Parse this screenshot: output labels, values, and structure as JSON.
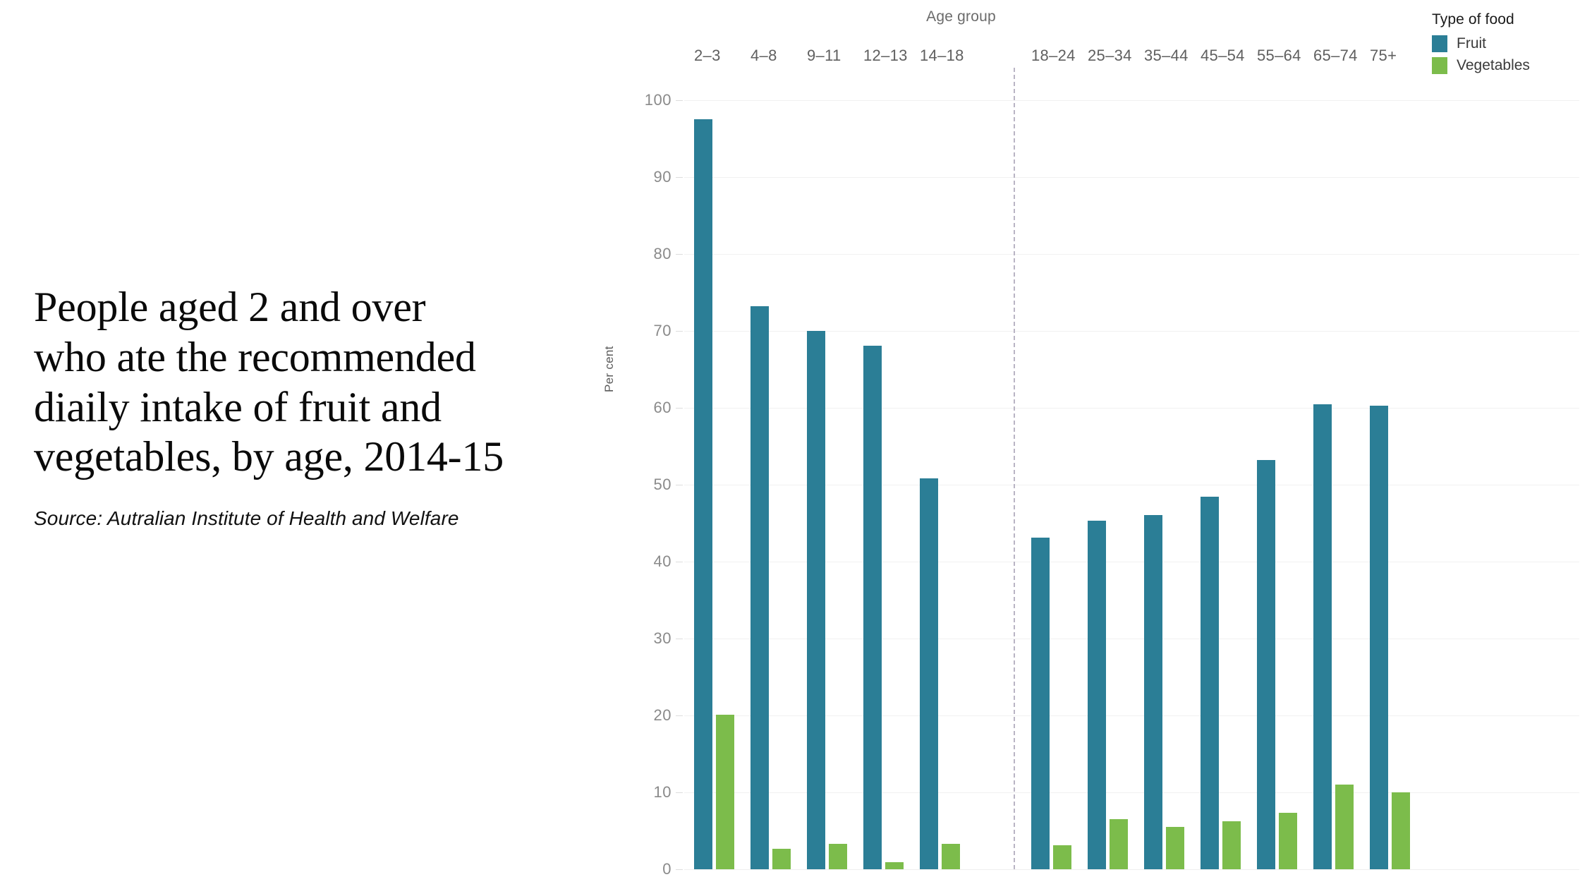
{
  "headline": "People aged 2 and over\nwho ate the recommended\ndiaily intake of fruit and\nvegetables, by age, 2014-15",
  "source": "Source: Autralian Institute of Health and Welfare",
  "legend": {
    "title": "Type of food",
    "items": [
      {
        "label": "Fruit",
        "color": "#2b7e96"
      },
      {
        "label": "Vegetables",
        "color": "#7cbc4b"
      }
    ]
  },
  "chart_data": {
    "type": "bar",
    "title": "People aged 2 and over who ate the recommended diaily intake of fruit and vegetables, by age, 2014-15",
    "subtitle": "Source: Autralian Institute of Health and Welfare",
    "xlabel": "Age group",
    "ylabel": "Per cent",
    "ylim": [
      0,
      100
    ],
    "yticks": [
      0,
      10,
      20,
      30,
      40,
      50,
      60,
      70,
      80,
      90,
      100
    ],
    "ytick_labels": [
      "0",
      "10",
      "20",
      "30",
      "40",
      "50",
      "60",
      "70",
      "80",
      "90",
      "100"
    ],
    "grid": true,
    "legend_position": "top-right",
    "legend_title": "Type of food",
    "panels": [
      {
        "name": "children",
        "categories": [
          "2–3",
          "4–8",
          "9–11",
          "12–13",
          "14–18"
        ]
      },
      {
        "name": "adults",
        "categories": [
          "18–24",
          "25–34",
          "35–44",
          "45–54",
          "55–64",
          "65–74",
          "75+"
        ]
      }
    ],
    "categories": [
      "2–3",
      "4–8",
      "9–11",
      "12–13",
      "14–18",
      "18–24",
      "25–34",
      "35–44",
      "45–54",
      "55–64",
      "65–74",
      "75+"
    ],
    "series": [
      {
        "name": "Fruit",
        "color": "#2b7e96",
        "values": [
          97.5,
          73.2,
          70.0,
          68.1,
          50.8,
          43.1,
          45.3,
          46.1,
          48.4,
          53.2,
          60.5,
          60.3
        ]
      },
      {
        "name": "Vegetables",
        "color": "#7cbc4b",
        "values": [
          20.1,
          2.7,
          3.3,
          0.9,
          3.3,
          3.1,
          6.5,
          5.5,
          6.2,
          7.3,
          11.0,
          10.0
        ]
      }
    ]
  }
}
